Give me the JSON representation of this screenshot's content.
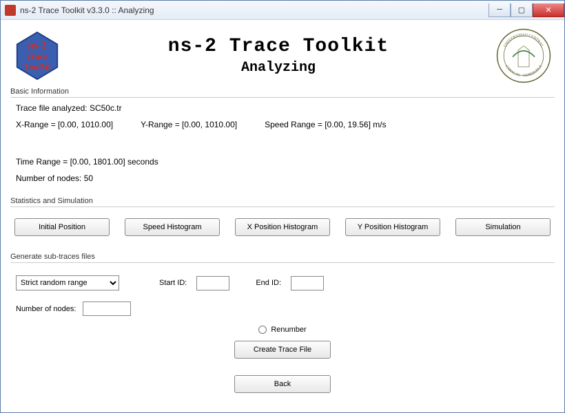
{
  "window": {
    "title": "ns-2 Trace Toolkit v3.3.0 :: Analyzing"
  },
  "header": {
    "app_title": "ns-2 Trace Toolkit",
    "subtitle": "Analyzing",
    "logo_text_top": "ns-2",
    "logo_text_mid": "Trace",
    "logo_text_bot": "Toolkit",
    "seal_top": "UNIVERSIDAD CENTRAL",
    "seal_bot": "CARACAS - VENEZUELA"
  },
  "basic": {
    "section_label": "Basic Information",
    "trace_file": "Trace file analyzed: SC50c.tr",
    "x_range": "X-Range = [0.00, 1010.00]",
    "y_range": "Y-Range = [0.00, 1010.00]",
    "speed_range": "Speed Range = [0.00, 19.56] m/s",
    "time_range": "Time Range = [0.00, 1801.00] seconds",
    "num_nodes": "Number of nodes: 50"
  },
  "stats": {
    "section_label": "Statistics and Simulation",
    "btn_initial": "Initial Position",
    "btn_speed": "Speed Histogram",
    "btn_xpos": "X Position Histogram",
    "btn_ypos": "Y Position Histogram",
    "btn_sim": "Simulation"
  },
  "sub": {
    "section_label": "Generate sub-traces files",
    "mode_selected": "Strict random range",
    "start_id_label": "Start ID:",
    "start_id_value": "",
    "end_id_label": "End ID:",
    "end_id_value": "",
    "num_nodes_label": "Number of nodes:",
    "num_nodes_value": "",
    "renumber_label": "Renumber",
    "create_btn": "Create Trace File",
    "back_btn": "Back"
  }
}
